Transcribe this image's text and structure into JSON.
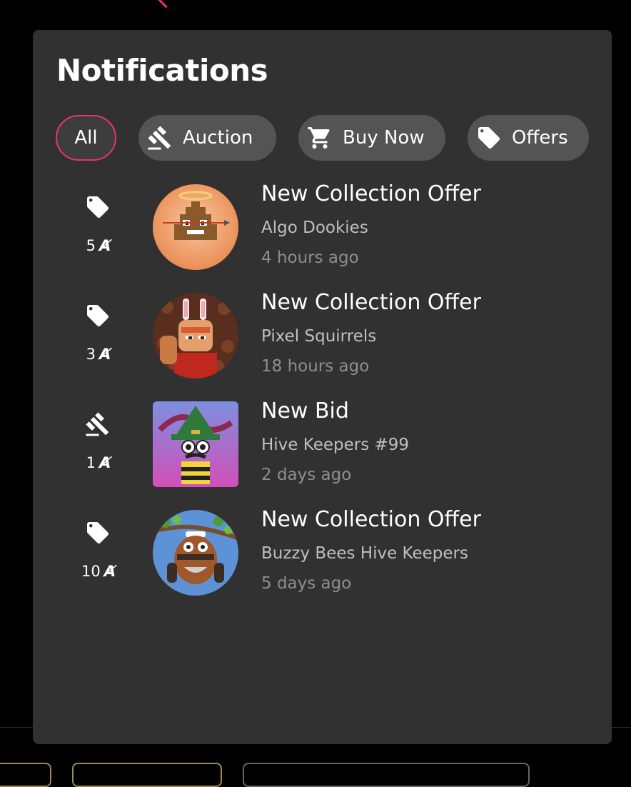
{
  "notifications": {
    "title": "Notifications",
    "filters": [
      {
        "label": "All",
        "icon": null,
        "active": true
      },
      {
        "label": "Auction",
        "icon": "gavel-icon",
        "active": false
      },
      {
        "label": "Buy Now",
        "icon": "cart-icon",
        "active": false
      },
      {
        "label": "Offers",
        "icon": "tag-icon",
        "active": false
      }
    ],
    "items": [
      {
        "type_icon": "tag-icon",
        "amount": "5",
        "currency_symbol": "Ⱥ",
        "title": "New Collection Offer",
        "collection": "Algo Dookies",
        "time": "4 hours ago"
      },
      {
        "type_icon": "tag-icon",
        "amount": "3",
        "currency_symbol": "Ⱥ",
        "title": "New Collection Offer",
        "collection": "Pixel Squirrels",
        "time": "18 hours ago"
      },
      {
        "type_icon": "gavel-icon",
        "amount": "1",
        "currency_symbol": "Ⱥ",
        "title": "New Bid",
        "collection": "Hive Keepers #99",
        "time": "2 days ago"
      },
      {
        "type_icon": "tag-icon",
        "amount": "10",
        "currency_symbol": "Ⱥ",
        "title": "New Collection Offer",
        "collection": "Buzzy Bees Hive Keepers",
        "time": "5 days ago"
      }
    ]
  },
  "colors": {
    "accent": "#e8307f",
    "panel_bg": "#313131",
    "chip_bg": "#545454",
    "page_bg": "#000000"
  }
}
